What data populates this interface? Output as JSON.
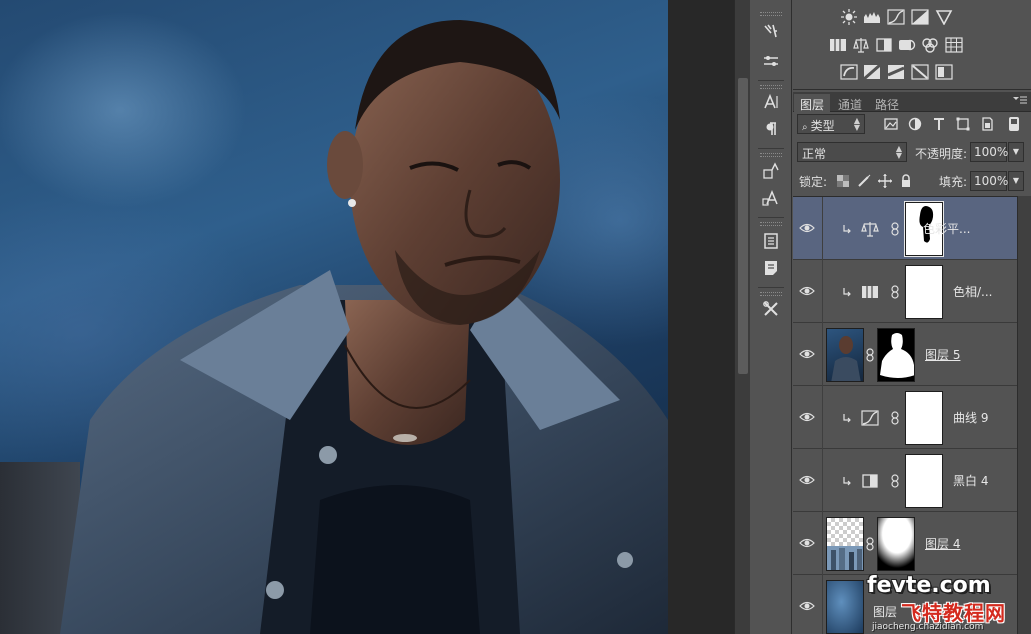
{
  "panels": {
    "tabs": [
      "图层",
      "通道",
      "路径"
    ]
  },
  "filter": {
    "kind_label": "类型"
  },
  "blend": {
    "mode": "正常",
    "opacity_label": "不透明度:",
    "opacity_value": "100%",
    "lock_label": "锁定:",
    "fill_label": "填充:",
    "fill_value": "100%"
  },
  "layers": [
    {
      "name": "色彩平...",
      "type": "color-balance-adjustment",
      "clipped": true,
      "selected": true,
      "icon": "balance-scale-icon"
    },
    {
      "name": "色相/...",
      "type": "hue-saturation-adjustment",
      "clipped": true,
      "selected": false,
      "icon": "hue-saturation-icon"
    },
    {
      "name": "图层 5",
      "type": "pixel-layer-with-mask",
      "clipped": false,
      "selected": false
    },
    {
      "name": "曲线 9",
      "type": "curves-adjustment",
      "clipped": true,
      "selected": false,
      "icon": "curves-icon"
    },
    {
      "name": "黑白 4",
      "type": "black-white-adjustment",
      "clipped": true,
      "selected": false,
      "icon": "black-white-icon"
    },
    {
      "name": "图层 4",
      "type": "pixel-layer-with-mask",
      "clipped": false,
      "selected": false
    },
    {
      "name": "图层",
      "type": "pixel-layer",
      "clipped": false,
      "selected": false
    }
  ],
  "watermark": {
    "logo": "fevte.com",
    "subtitle": "飞特教程网",
    "url": "jiaocheng.chazidian.com"
  },
  "colors": {
    "panel_bg": "#535353",
    "selected_row": "#596580",
    "canvas_bg": "#282828"
  }
}
